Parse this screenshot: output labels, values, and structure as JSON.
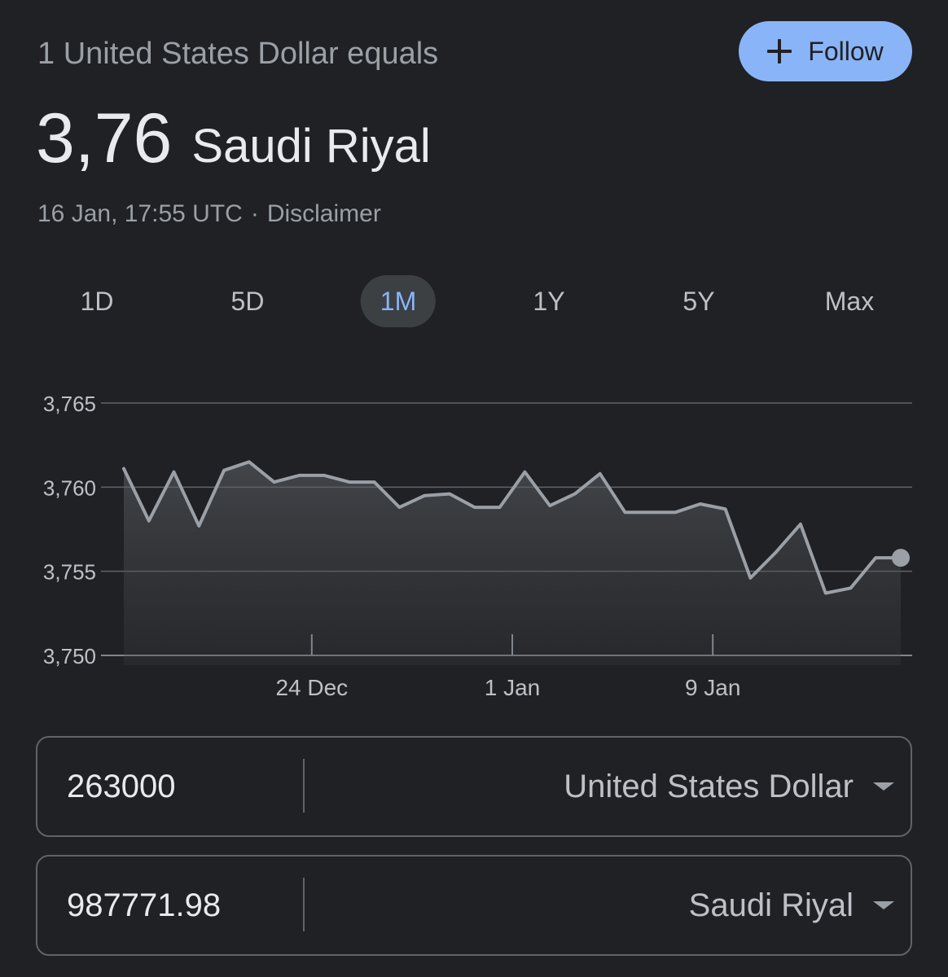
{
  "header": {
    "subtitle": "1 United States Dollar equals",
    "follow_label": "Follow"
  },
  "rate": {
    "value": "3,76",
    "currency": "Saudi Riyal"
  },
  "meta": {
    "timestamp": "16 Jan, 17:55 UTC",
    "separator": "·",
    "disclaimer": "Disclaimer"
  },
  "range_tabs": [
    {
      "label": "1D",
      "active": false
    },
    {
      "label": "5D",
      "active": false
    },
    {
      "label": "1M",
      "active": true
    },
    {
      "label": "1Y",
      "active": false
    },
    {
      "label": "5Y",
      "active": false
    },
    {
      "label": "Max",
      "active": false
    }
  ],
  "chart_data": {
    "type": "area",
    "y_ticks": [
      "3,765",
      "3,760",
      "3,755",
      "3,750"
    ],
    "ylim": [
      3.75,
      3.765
    ],
    "x_ticks": [
      {
        "label": "24 Dec",
        "index": 7.5
      },
      {
        "label": "1 Jan",
        "index": 15.5
      },
      {
        "label": "9 Jan",
        "index": 23.5
      }
    ],
    "values": [
      3.7611,
      3.758,
      3.7609,
      3.7577,
      3.761,
      3.7615,
      3.7603,
      3.7607,
      3.7607,
      3.7603,
      3.7603,
      3.7588,
      3.7595,
      3.7596,
      3.7588,
      3.7588,
      3.7609,
      3.7589,
      3.7596,
      3.7608,
      3.7585,
      3.7585,
      3.7585,
      3.759,
      3.7587,
      3.7546,
      3.7561,
      3.7578,
      3.7537,
      3.754,
      3.7558,
      3.7558
    ],
    "line_color": "#9aa0a6",
    "grid": true
  },
  "converter": {
    "from": {
      "amount": "263000",
      "currency": "United States Dollar"
    },
    "to": {
      "amount": "987771.98",
      "currency": "Saudi Riyal"
    }
  }
}
